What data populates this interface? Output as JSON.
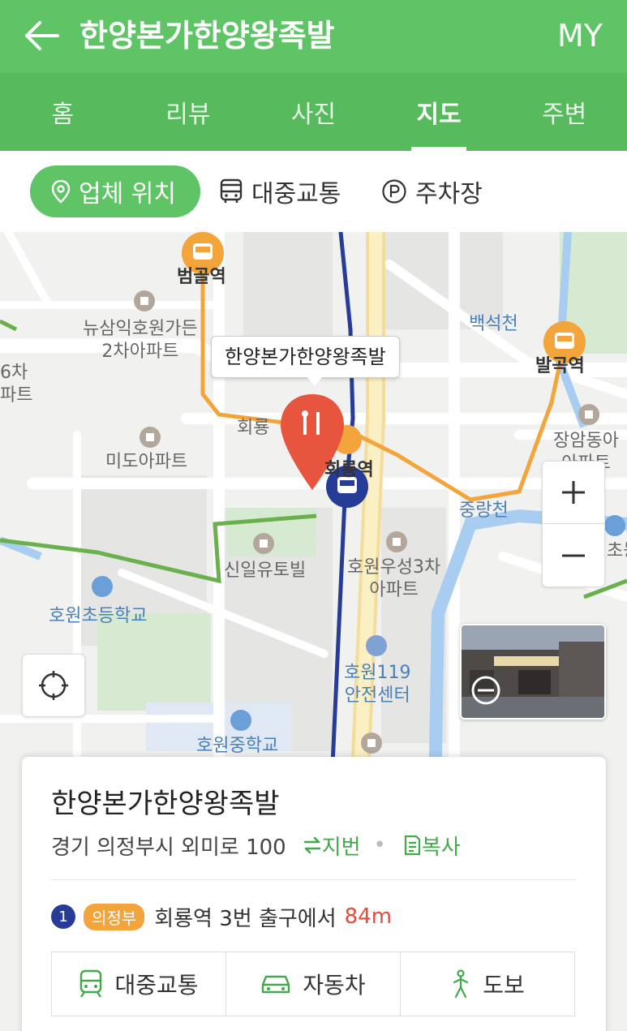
{
  "header": {
    "title": "한양본가한양왕족발",
    "my_label": "MY"
  },
  "tabs": [
    {
      "label": "홈",
      "active": false
    },
    {
      "label": "리뷰",
      "active": false
    },
    {
      "label": "사진",
      "active": false
    },
    {
      "label": "지도",
      "active": true
    },
    {
      "label": "주변",
      "active": false
    }
  ],
  "filters": {
    "location": "업체 위치",
    "transit": "대중교통",
    "parking": "주차장"
  },
  "map": {
    "callout": "한양본가한양왕족발",
    "labels": {
      "beomgol_station": "범골역",
      "newsam_apt_1": "뉴삼익호원가든",
      "newsam_apt_2": "2차아파트",
      "apt6_1": "6차",
      "apt6_2": "파트",
      "baekseokcheon": "백석천",
      "balgok_station": "발곡역",
      "huiryong_left": "회룡",
      "huiryong_station": "회룡역",
      "mido_apt": "미도아파트",
      "jangam_1": "장암동아",
      "jangam_2": "아파트",
      "jungnangcheon": "중랑천",
      "sinil": "신일유토빌",
      "howon_useong_1": "호원우성3차",
      "howon_useong_2": "아파트",
      "right_edge": "초등",
      "howon_elem": "호원초등학교",
      "howon119_1": "호원119",
      "howon119_2": "안전센터",
      "howon_middle": "호원중학교"
    },
    "colors": {
      "subway_line1": "#263c96",
      "light_rail": "#f3a43b",
      "stream": "#a9cdf0",
      "park": "#cfe6c9",
      "marker": "#e8553e"
    }
  },
  "card": {
    "title": "한양본가한양왕족발",
    "address": "경기 의정부시 외미로 100",
    "jibun_label": "지번",
    "copy_label": "복사",
    "subway_line": "1",
    "branch": "의정부",
    "station_text": "회룡역 3번 출구에서",
    "distance": "84m",
    "buttons": {
      "transit": "대중교통",
      "car": "자동차",
      "walk": "도보"
    }
  }
}
